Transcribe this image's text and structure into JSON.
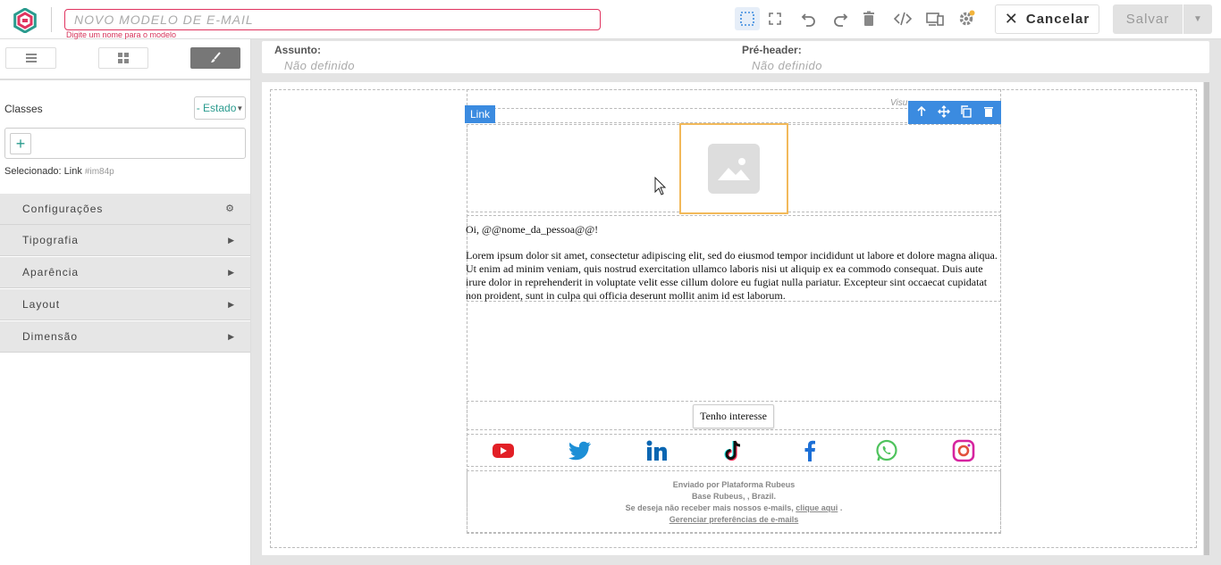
{
  "topbar": {
    "name_placeholder": "NOVO MODELO DE E-MAIL",
    "name_hint": "Digite um nome para o modelo",
    "cancel_label": "Cancelar",
    "save_label": "Salvar",
    "tools": [
      "select-icon",
      "fullscreen-icon",
      "undo-icon",
      "redo-icon",
      "trash-icon",
      "code-icon",
      "devices-icon",
      "gear-icon"
    ],
    "accent_color": "#e0335f"
  },
  "sidebar": {
    "classes_label": "Classes",
    "state_select": "- Estado",
    "selected_label": "Selecionado:",
    "selected_name": "Link",
    "selected_id": "#im84p",
    "sections": [
      {
        "label": "Configurações",
        "icon": "gear-icon"
      },
      {
        "label": "Tipografia",
        "icon": "chevron-right-icon"
      },
      {
        "label": "Aparência",
        "icon": "chevron-right-icon"
      },
      {
        "label": "Layout",
        "icon": "chevron-right-icon"
      },
      {
        "label": "Dimensão",
        "icon": "chevron-right-icon"
      }
    ]
  },
  "header": {
    "subject_label": "Assunto:",
    "subject_value": "Não definido",
    "preheader_label": "Pré-header:",
    "preheader_value": "Não definido"
  },
  "canvas": {
    "view_online": "Visu",
    "link_badge": "Link",
    "greeting": "Oi, @@nome_da_pessoa@@!",
    "lorem": "Lorem ipsum dolor sit amet, consectetur adipiscing elit, sed do eiusmod tempor incididunt ut labore et dolore magna aliqua. Ut enim ad minim veniam, quis nostrud exercitation ullamco laboris nisi ut aliquip ex ea commodo consequat. Duis aute irure dolor in reprehenderit in voluptate velit esse cillum dolore eu fugiat nulla pariatur. Excepteur sint occaecat cupidatat non proident, sunt in culpa qui officia deserunt mollit anim id est laborum.",
    "cta_label": "Tenho interesse",
    "social": [
      "youtube-icon",
      "twitter-icon",
      "linkedin-icon",
      "tiktok-icon",
      "facebook-icon",
      "whatsapp-icon",
      "instagram-icon"
    ],
    "footer_line1": "Enviado por Plataforma Rubeus",
    "footer_line2": "Base Rubeus, , Brazil.",
    "footer_line3_pre": "Se deseja não receber mais nossos e-mails,",
    "footer_line3_link": "clique aqui",
    "footer_line3_post": ".",
    "footer_line4": "Gerenciar preferências de e-mails"
  }
}
